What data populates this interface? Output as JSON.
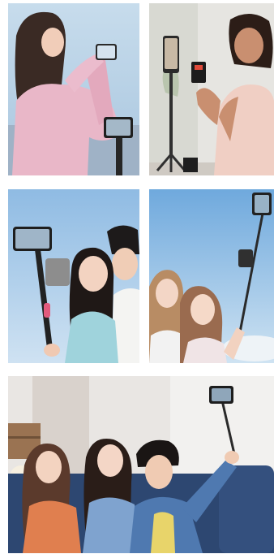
{
  "gallery": {
    "photos": [
      {
        "subject": "woman-filming-with-phone-on-selfie-stick-tripod"
      },
      {
        "subject": "woman-using-remote-with-phone-on-desk-tripod"
      },
      {
        "subject": "couple-taking-selfie-with-stabilizer-stick"
      },
      {
        "subject": "two-women-taking-selfie-with-extended-stick"
      },
      {
        "subject": "three-friends-on-sofa-taking-selfie-with-stick"
      }
    ]
  },
  "colors": {
    "sky": "#b7d3ec",
    "pink_jacket": "#e9b7c8",
    "stick": "#2b2b2b",
    "sofa": "#2d4771",
    "denim": "#4f79b0"
  }
}
